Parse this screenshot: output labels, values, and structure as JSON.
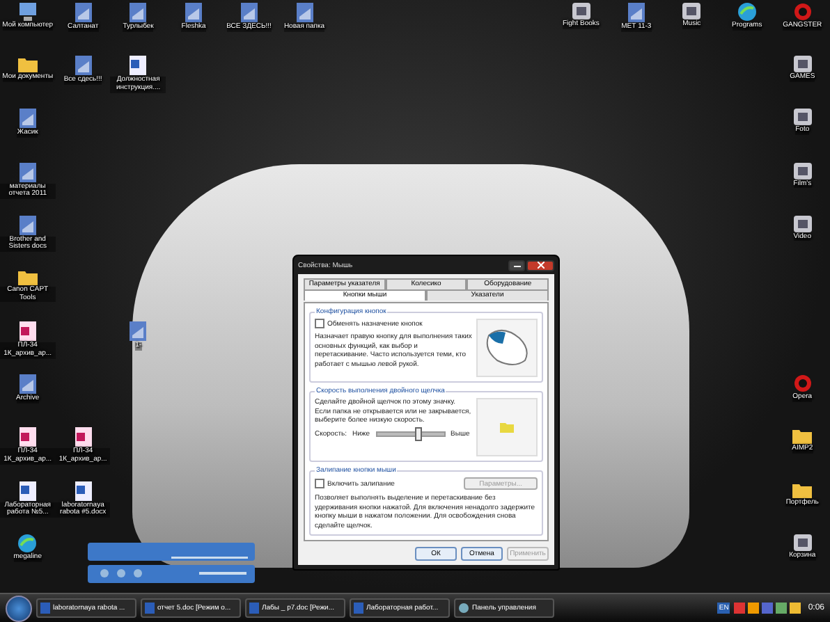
{
  "desktop_icons": [
    {
      "label": "Мой компьютер",
      "kind": "computer"
    },
    {
      "label": "Салтанат",
      "kind": "doc"
    },
    {
      "label": "Турлыбек",
      "kind": "doc"
    },
    {
      "label": "Fleshka",
      "kind": "doc"
    },
    {
      "label": "ВСЕ ЗДЕСЬ!!!",
      "kind": "doc"
    },
    {
      "label": "Новая папка",
      "kind": "doc"
    },
    {
      "label": "Fight Books",
      "kind": "app"
    },
    {
      "label": "МЕТ 11-3",
      "kind": "doc"
    },
    {
      "label": "Music",
      "kind": "app"
    },
    {
      "label": "Programs",
      "kind": "globe"
    },
    {
      "label": "GANGSTER",
      "kind": "stop"
    },
    {
      "label": "Мои документы",
      "kind": "folder"
    },
    {
      "label": "Все сдесь!!!",
      "kind": "doc"
    },
    {
      "label": "Должностная инструкция....",
      "kind": "word"
    },
    {
      "label": "GAMES",
      "kind": "app"
    },
    {
      "label": "Жасик",
      "kind": "doc"
    },
    {
      "label": "Foto",
      "kind": "app"
    },
    {
      "label": "материалы отчета 2011",
      "kind": "doc"
    },
    {
      "label": "Film's",
      "kind": "app"
    },
    {
      "label": "Brother and Sisters docs",
      "kind": "doc"
    },
    {
      "label": "Video",
      "kind": "app"
    },
    {
      "label": "Canon CAPT Tools",
      "kind": "folder"
    },
    {
      "label": "ПЛ-34 1К_архив_ар...",
      "kind": "access"
    },
    {
      "label": "1-",
      "kind": "doc"
    },
    {
      "label": "Archive",
      "kind": "doc"
    },
    {
      "label": "Opera",
      "kind": "stop"
    },
    {
      "label": "ПЛ-34 1К_архив_ар...",
      "kind": "access"
    },
    {
      "label": "ПЛ-34 1К_архив_ар...",
      "kind": "access"
    },
    {
      "label": "AIMP2",
      "kind": "folder"
    },
    {
      "label": "Лабораторная работа №5...",
      "kind": "word"
    },
    {
      "label": "laboratornaya rabota #5.docx",
      "kind": "word"
    },
    {
      "label": "Портфель",
      "kind": "folder"
    },
    {
      "label": "megaline",
      "kind": "globe"
    },
    {
      "label": "Корзина",
      "kind": "app"
    }
  ],
  "dialog": {
    "title": "Свойства: Мышь",
    "tab_rows": [
      [
        {
          "label": "Параметры указателя",
          "selected": false
        },
        {
          "label": "Колесико",
          "selected": false
        },
        {
          "label": "Оборудование",
          "selected": false
        }
      ],
      [
        {
          "label": "Кнопки мыши",
          "selected": true
        },
        {
          "label": "Указатели",
          "selected": false
        }
      ]
    ],
    "button_config": {
      "heading": "Конфигурация кнопок",
      "checkbox": {
        "label": "Обменять назначение кнопок",
        "checked": false
      },
      "description": "Назначает правую кнопку для выполнения таких основных функций, как выбор и перетаскивание. Часто используется теми, кто работает с мышью левой рукой."
    },
    "double_click": {
      "heading": "Скорость выполнения двойного щелчка",
      "description": "Сделайте двойной щелчок по этому значку. Если папка не открывается или не закрывается, выберите более низкую скорость.",
      "speed_label": "Скорость:",
      "low_label": "Ниже",
      "high_label": "Выше",
      "level": 0.62
    },
    "click_lock": {
      "heading": "Залипание кнопки мыши",
      "checkbox": {
        "label": "Включить залипание",
        "checked": false
      },
      "settings_button": {
        "label": "Параметры...",
        "disabled": true
      },
      "description": "Позволяет выполнять выделение и перетаскивание без удерживания кнопки нажатой. Для включения ненадолго задержите кнопку мыши в нажатом положении. Для освобождения снова сделайте щелчок."
    },
    "buttons": [
      {
        "label": "ОК",
        "disabled": false
      },
      {
        "label": "Отмена",
        "disabled": false
      },
      {
        "label": "Применить",
        "disabled": true
      }
    ]
  },
  "taskbar": {
    "tasks": [
      {
        "label": "laboratornaya rabota ...",
        "kind": "word"
      },
      {
        "label": "отчет 5.doc [Режим о...",
        "kind": "word"
      },
      {
        "label": "Лабы _ р7.doc [Режи...",
        "kind": "word"
      },
      {
        "label": "Лабораторная работ...",
        "kind": "word"
      },
      {
        "label": "Панель управления",
        "kind": "control"
      }
    ],
    "language": "EN",
    "clock": "0:06"
  }
}
